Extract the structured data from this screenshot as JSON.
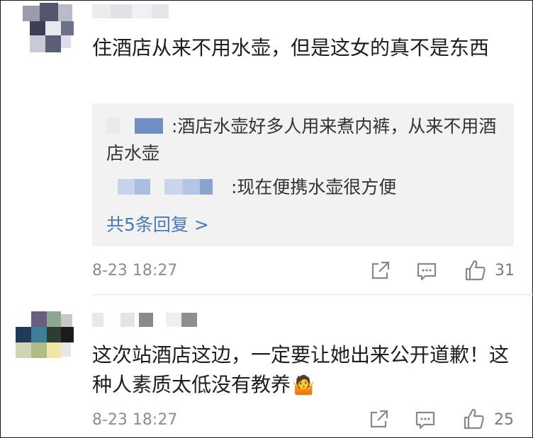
{
  "comments": [
    {
      "text": "住酒店从来不用水壶，但是这女的真不是东西",
      "replies": [
        {
          "text": ":酒店水壶好多人用来煮内裤，从来不用酒店水壶"
        },
        {
          "text": ":现在便携水壶很方便"
        }
      ],
      "more_replies": "共5条回复 >",
      "time": "8-23 18:27",
      "likes": "31"
    },
    {
      "text": "这次站酒店这边，一定要让她出来公开道歉！这种人素质太低没有教养",
      "emoji": "🤷",
      "time": "8-23 18:27",
      "likes": "25"
    }
  ],
  "icons": {
    "share": "share-icon",
    "comment": "comment-icon",
    "like": "thumbs-up-icon"
  },
  "colors": {
    "link": "#4a78b8",
    "reply_bg": "#f2f2f2",
    "meta": "#8d8d8d"
  }
}
